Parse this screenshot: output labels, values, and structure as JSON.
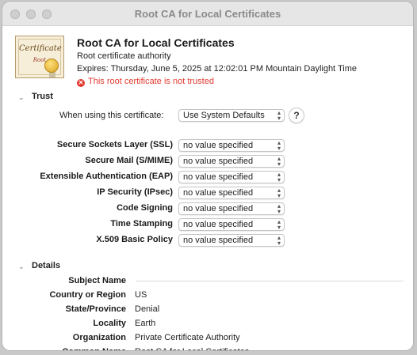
{
  "window": {
    "title": "Root CA for Local Certificates"
  },
  "header": {
    "icon_text_top": "Certificate",
    "icon_text_bottom": "Root",
    "name": "Root CA for Local Certificates",
    "subtitle": "Root certificate authority",
    "expires": "Expires: Thursday, June 5, 2025 at 12:02:01 PM Mountain Daylight Time",
    "warning": "This root certificate is not trusted"
  },
  "trust": {
    "section_label": "Trust",
    "using_label": "When using this certificate:",
    "using_value": "Use System Defaults",
    "help": "?",
    "policies": [
      {
        "label": "Secure Sockets Layer (SSL)",
        "value": "no value specified"
      },
      {
        "label": "Secure Mail (S/MIME)",
        "value": "no value specified"
      },
      {
        "label": "Extensible Authentication (EAP)",
        "value": "no value specified"
      },
      {
        "label": "IP Security (IPsec)",
        "value": "no value specified"
      },
      {
        "label": "Code Signing",
        "value": "no value specified"
      },
      {
        "label": "Time Stamping",
        "value": "no value specified"
      },
      {
        "label": "X.509 Basic Policy",
        "value": "no value specified"
      }
    ]
  },
  "details": {
    "section_label": "Details",
    "rows": [
      {
        "label": "Subject Name",
        "value": ""
      },
      {
        "label": "Country or Region",
        "value": "US"
      },
      {
        "label": "State/Province",
        "value": "Denial"
      },
      {
        "label": "Locality",
        "value": "Earth"
      },
      {
        "label": "Organization",
        "value": "Private Certificate Authority"
      },
      {
        "label": "Common Name",
        "value": "Root CA for Local Certificates"
      }
    ]
  },
  "colors": {
    "warning": "#e23a30",
    "background": "#ffffff"
  }
}
